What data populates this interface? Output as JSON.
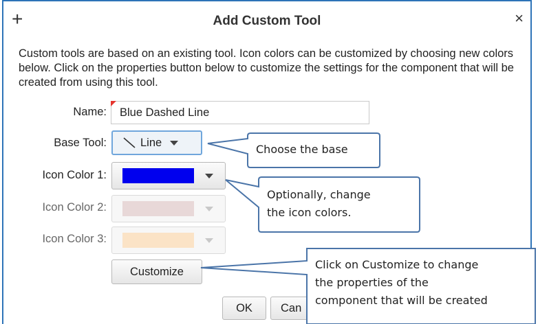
{
  "dialog": {
    "title": "Add Custom Tool",
    "add_icon": "+",
    "close_icon": "×",
    "description": "Custom tools are based on an existing tool.  Icon colors can be customized by choosing new colors below.  Click on the properties button below to customize the settings for the component that will be created from using this tool."
  },
  "form": {
    "name_label": "Name:",
    "name_value": "Blue Dashed Line",
    "base_tool_label": "Base Tool:",
    "base_tool_value": "Line",
    "base_tool_icon": "diagonal-line-icon",
    "icon_color_1_label": "Icon Color 1:",
    "icon_color_1": "#0000ee",
    "icon_color_2_label": "Icon Color 2:",
    "icon_color_2": "#e8d8d8",
    "icon_color_3_label": "Icon Color 3:",
    "icon_color_3": "#fbe3c6"
  },
  "buttons": {
    "customize": "Customize",
    "ok": "OK",
    "cancel_visible": "Can"
  },
  "callouts": {
    "base": "Choose the base",
    "colors_line1": "Optionally, change",
    "colors_line2": "the icon colors.",
    "customize_line1": "Click on Customize to change",
    "customize_line2": "the properties of the",
    "customize_line3": "component that will be created"
  },
  "colors": {
    "dialog_border": "#2d73b8",
    "callout_border": "#4a74a8",
    "required_marker": "#e5352f"
  }
}
